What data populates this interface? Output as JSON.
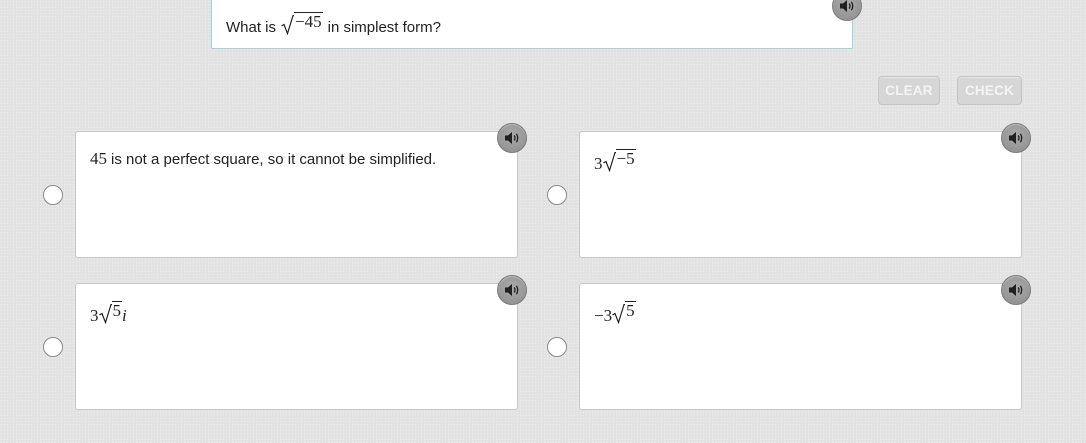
{
  "question": {
    "prefix": "What is",
    "radicand": "−45",
    "suffix": "in simplest form?",
    "audio_icon": "speaker-icon"
  },
  "toolbar": {
    "clear_label": "CLEAR",
    "check_label": "CHECK"
  },
  "options": [
    {
      "number": "45",
      "text": "is not a perfect square, so it cannot be simplified."
    },
    {
      "coefficient": "3",
      "radicand": "−5"
    },
    {
      "coefficient": "3",
      "radicand": "5",
      "suffix": "i"
    },
    {
      "coefficient": "−3",
      "radicand": "5"
    }
  ],
  "colors": {
    "question_border": "#9fd3da",
    "button_bg": "#d6d6d6",
    "speaker_bg": "#8e8e8e"
  }
}
